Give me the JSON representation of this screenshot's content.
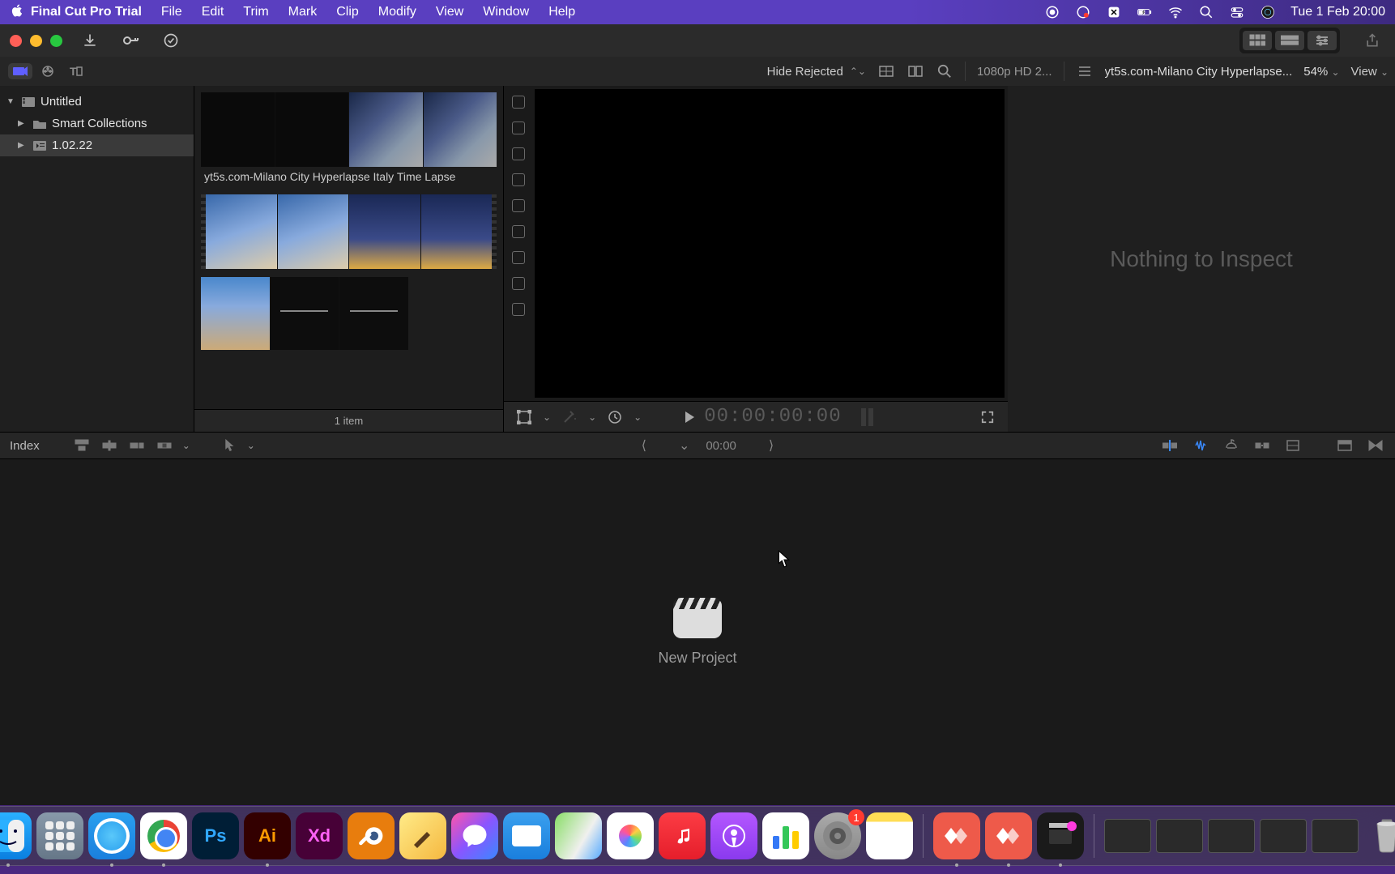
{
  "menubar": {
    "app_name": "Final Cut Pro Trial",
    "items": [
      "File",
      "Edit",
      "Trim",
      "Mark",
      "Clip",
      "Modify",
      "View",
      "Window",
      "Help"
    ],
    "datetime": "Tue 1 Feb  20:00"
  },
  "toolbar2": {
    "hide_rejected": "Hide Rejected",
    "format": "1080p HD 2...",
    "project_title": "yt5s.com-Milano City Hyperlapse...",
    "zoom": "54%",
    "view": "View"
  },
  "sidebar": {
    "library": "Untitled",
    "items": [
      {
        "label": "Smart Collections",
        "icon": "folder"
      },
      {
        "label": "1.02.22",
        "icon": "event"
      }
    ]
  },
  "browser": {
    "clip1_label": "yt5s.com-Milano City Hyperlapse Italy Time Lapse",
    "footer": "1 item"
  },
  "viewer": {
    "timecode": "00:00:00:00"
  },
  "inspector": {
    "message": "Nothing to Inspect"
  },
  "tl_toolbar": {
    "index": "Index",
    "time": "00:00"
  },
  "timeline": {
    "new_project": "New Project"
  },
  "dock": {
    "settings_badge": "1",
    "ps": "Ps",
    "ai": "Ai",
    "xd": "Xd"
  }
}
